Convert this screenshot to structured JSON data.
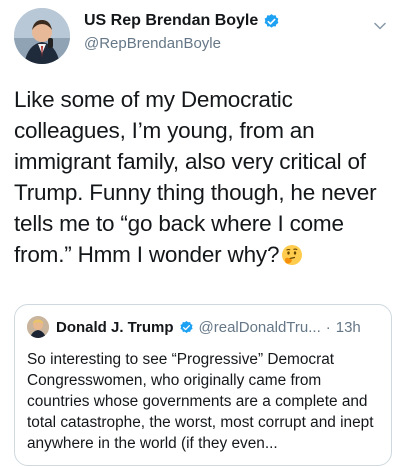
{
  "author": {
    "display_name": "US Rep Brendan Boyle",
    "handle": "@RepBrendanBoyle",
    "verified": true
  },
  "tweet": {
    "text": "Like some of my Democratic colleagues, I’m young, from an immigrant family, also very critical of Trump. Funny thing though, he never tells me to “go back where I come from.” Hmm I wonder why?",
    "emoji": "thinking-face-icon"
  },
  "quoted_tweet": {
    "display_name": "Donald J. Trump",
    "handle": "@realDonaldTru...",
    "separator": "·",
    "time": "13h",
    "verified": true,
    "text": "So interesting to see “Progressive” Democrat Congresswomen, who originally came from countries whose governments are a complete and total catastrophe, the worst, most corrupt and inept anywhere in the world (if they even..."
  },
  "colors": {
    "text_primary": "#14171a",
    "text_secondary": "#657786",
    "verified_blue": "#1da1f2",
    "card_border": "#cfd9de"
  },
  "icons": {
    "verified": "verified-badge-icon",
    "menu": "chevron-down-icon"
  }
}
